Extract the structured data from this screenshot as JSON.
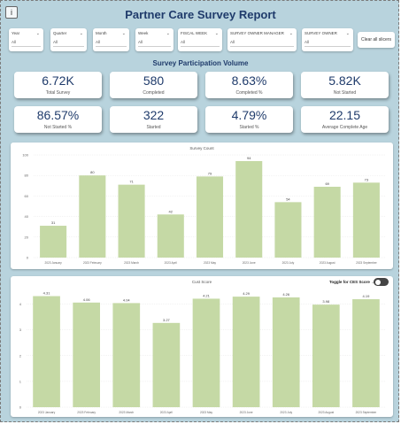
{
  "header": {
    "info_icon": "i",
    "title": "Partner Care Survey Report"
  },
  "filters": [
    {
      "label": "Year",
      "value": "All"
    },
    {
      "label": "Quarter",
      "value": "All"
    },
    {
      "label": "Month",
      "value": "All"
    },
    {
      "label": "Week",
      "value": "All"
    },
    {
      "label": "FISCAL WEEK",
      "value": "All"
    },
    {
      "label": "SURVEY OWNER MANAGER",
      "value": "All"
    },
    {
      "label": "SURVEY OWNER",
      "value": "All"
    }
  ],
  "clear_button": "Clear all slicers",
  "section_title": "Survey Participation Volume",
  "kpis": [
    {
      "value": "6.72K",
      "label": "Total Survey"
    },
    {
      "value": "580",
      "label": "Completed"
    },
    {
      "value": "8.63%",
      "label": "Completed %"
    },
    {
      "value": "5.82K",
      "label": "Not Started"
    },
    {
      "value": "86.57%",
      "label": "Not Started %"
    },
    {
      "value": "322",
      "label": "Started"
    },
    {
      "value": "4.79%",
      "label": "Started %"
    },
    {
      "value": "22.15",
      "label": "Average Complete Age"
    }
  ],
  "toggle": {
    "label": "Toggle for CES Score →",
    "state": "off"
  },
  "colors": {
    "bar": "#c5d9a5",
    "accent": "#1f3b6b",
    "background": "#b8d3dd"
  },
  "chart_data": [
    {
      "type": "bar",
      "title": "Survey Count",
      "categories": [
        "2023 January",
        "2023 February",
        "2023 March",
        "2023 April",
        "2023 May",
        "2023 June",
        "2023 July",
        "2023 August",
        "2023 September"
      ],
      "values": [
        31,
        80,
        71,
        42,
        79,
        94,
        54,
        69,
        73
      ],
      "data_labels": [
        "31",
        "80",
        "71",
        "42",
        "79",
        "94",
        "54",
        "69",
        "73"
      ],
      "ylim": [
        0,
        100
      ],
      "yticks": [
        0,
        20,
        40,
        60,
        80,
        100
      ]
    },
    {
      "type": "bar",
      "title": "Cust Score",
      "categories": [
        "2023 January",
        "2023 February",
        "2023 March",
        "2023 April",
        "2023 May",
        "2023 June",
        "2023 July",
        "2023 August",
        "2023 September"
      ],
      "values": [
        4.31,
        4.06,
        4.04,
        3.27,
        4.21,
        4.29,
        4.26,
        3.98,
        4.19
      ],
      "data_labels": [
        "4.31",
        "4.06",
        "4.04",
        "3.27",
        "4.21",
        "4.29",
        "4.26",
        "3.98",
        "4.19"
      ],
      "ylim": [
        0,
        4.5
      ],
      "yticks": [
        0,
        1,
        2,
        3,
        4
      ]
    }
  ]
}
